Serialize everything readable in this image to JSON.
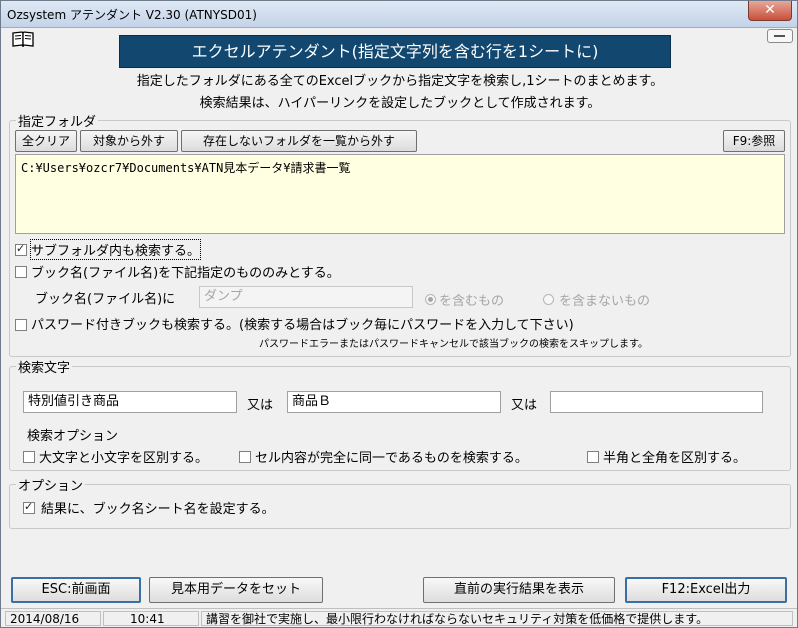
{
  "window": {
    "title": "Ozsystem アテンダント V2.30 (ATNYSD01)",
    "close_label": "✕"
  },
  "header": {
    "banner": "エクセルアテンダント(指定文字列を含む行を1シートに)",
    "desc1": "指定したフォルダにある全てのExcelブックから指定文字を検索し,1シートのまとめます。",
    "desc2": "検索結果は、ハイパーリンクを設定したブックとして作成されます。"
  },
  "folder": {
    "legend": "指定フォルダ",
    "btn_clear": "全クリア",
    "btn_remove": "対象から外す",
    "btn_remove_missing": "存在しないフォルダを一覧から外す",
    "btn_browse": "F9:参照",
    "path": "C:¥Users¥ozcr7¥Documents¥ATN見本データ¥請求書一覧",
    "subfolder_label": "サブフォルダ内も検索する。",
    "subfolder_checked": true,
    "bookname_label": "ブック名(ファイル名)を下記指定のもののみとする。",
    "bookname_checked": false,
    "bookname_field_label": "ブック名(ファイル名)に",
    "bookname_value": "ダンプ",
    "radio_contains": "を含むもの",
    "radio_not_contains": "を含まないもの",
    "password_label": "パスワード付きブックも検索する。(検索する場合はブック毎にパスワードを入力して下さい)",
    "password_checked": false,
    "password_note": "パスワードエラーまたはパスワードキャンセルで該当ブックの検索をスキップします。"
  },
  "search": {
    "legend": "検索文字",
    "term1": "特別値引き商品",
    "or1": "又は",
    "term2": "商品Ｂ",
    "or2": "又は",
    "term3": "",
    "options_title": "検索オプション",
    "opt_case": "大文字と小文字を区別する。",
    "opt_exact": "セル内容が完全に同一であるものを検索する。",
    "opt_width": "半角と全角を区別する。"
  },
  "options": {
    "legend": "オプション",
    "sheetname_label": "結果に、ブック名シート名を設定する。",
    "sheetname_checked": true
  },
  "buttons": {
    "back": "ESC:前画面",
    "sample": "見本用データをセット",
    "last_result": "直前の実行結果を表示",
    "run": "F12:Excel出力"
  },
  "status": {
    "date": "2014/08/16",
    "time": "10:41",
    "message": "講習を御社で実施し、最小限行わなければならないセキュリティ対策を低価格で提供します。"
  },
  "icons": [
    "book-icon",
    "close-icon",
    "minimize-icon"
  ]
}
